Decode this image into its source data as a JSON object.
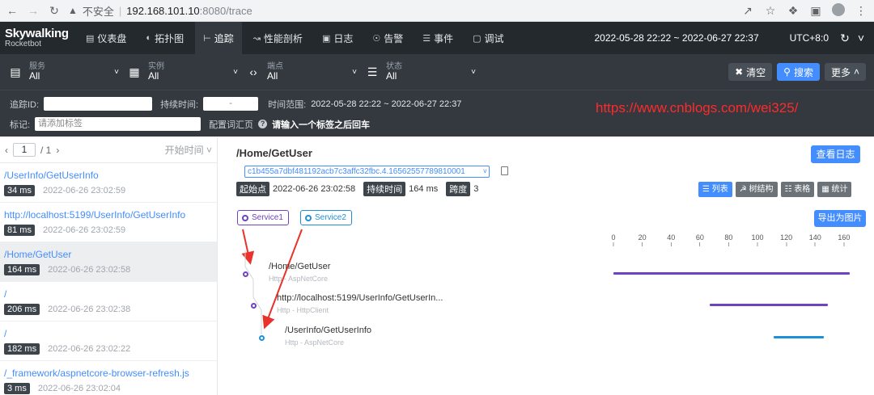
{
  "browser": {
    "insecure_label": "不安全",
    "host": "192.168.101.10",
    "path": ":8080/trace"
  },
  "brand": {
    "name": "Skywalking",
    "sub": "Rocketbot"
  },
  "menu": [
    {
      "label": "仪表盘",
      "icon": "dashboard-icon"
    },
    {
      "label": "拓扑图",
      "icon": "topology-icon"
    },
    {
      "label": "追踪",
      "icon": "trace-icon",
      "active": true
    },
    {
      "label": "性能剖析",
      "icon": "profile-icon"
    },
    {
      "label": "日志",
      "icon": "log-icon"
    },
    {
      "label": "告警",
      "icon": "alarm-icon"
    },
    {
      "label": "事件",
      "icon": "event-icon"
    },
    {
      "label": "调试",
      "icon": "debug-icon"
    }
  ],
  "header": {
    "daterange": "2022-05-28 22:22 ~ 2022-06-27 22:37",
    "timezone": "UTC+8:0"
  },
  "selectors": [
    {
      "label": "服务",
      "value": "All",
      "icon": "service-icon"
    },
    {
      "label": "实例",
      "value": "All",
      "icon": "instance-icon"
    },
    {
      "label": "端点",
      "value": "All",
      "icon": "endpoint-icon"
    },
    {
      "label": "状态",
      "value": "All",
      "icon": "status-icon"
    }
  ],
  "actions": {
    "clear": "清空",
    "search": "搜索",
    "more": "更多"
  },
  "filters": {
    "trace_id_label": "追踪ID:",
    "duration_label": "持续时间:",
    "duration_sep": "-",
    "time_range_label": "时间范围:",
    "time_range": "2022-05-28 22:22 ~ 2022-06-27 22:37",
    "tags_label": "标记:",
    "tags_placeholder": "请添加标签",
    "config_label": "配置词汇页",
    "tags_hint": "请输入一个标签之后回车"
  },
  "watermark": "https://www.cnblogs.com/wei325/",
  "pager": {
    "current": "1",
    "total": "/ 1",
    "sort": "开始时间"
  },
  "traces": [
    {
      "endpoint": "/UserInfo/GetUserInfo",
      "duration": "34 ms",
      "time": "2022-06-26 23:02:59"
    },
    {
      "endpoint": "http://localhost:5199/UserInfo/GetUserInfo",
      "duration": "81 ms",
      "time": "2022-06-26 23:02:59"
    },
    {
      "endpoint": "/Home/GetUser",
      "duration": "164 ms",
      "time": "2022-06-26 23:02:58",
      "selected": true
    },
    {
      "endpoint": "/",
      "duration": "206 ms",
      "time": "2022-06-26 23:02:38"
    },
    {
      "endpoint": "/",
      "duration": "182 ms",
      "time": "2022-06-26 23:02:22"
    },
    {
      "endpoint": "/_framework/aspnetcore-browser-refresh.js",
      "duration": "3 ms",
      "time": "2022-06-26 23:02:04"
    }
  ],
  "detail": {
    "title": "/Home/GetUser",
    "view_log": "查看日志",
    "trace_id": "c1b455a7dbf481192acb7c3affc32fbc.4.16562557789810001",
    "start_label": "起始点",
    "start": "2022-06-26 23:02:58",
    "duration_label": "持续时间",
    "duration": "164 ms",
    "span_label": "跨度",
    "span_count": "3",
    "views": [
      "列表",
      "树结构",
      "表格",
      "统计"
    ],
    "export": "导出为图片",
    "services": [
      {
        "name": "Service1",
        "color": "#6f42c1"
      },
      {
        "name": "Service2",
        "color": "#1e90d8"
      }
    ]
  },
  "timeline": {
    "ticks": [
      0,
      20,
      40,
      60,
      80,
      100,
      120,
      140,
      160
    ],
    "max": 164
  },
  "spans": [
    {
      "name": "/Home/GetUser",
      "sub": "Http - AspNetCore",
      "start": 0,
      "end": 164,
      "color": "#6f42c1",
      "depth": 0
    },
    {
      "name": "http://localhost:5199/UserInfo/GetUserIn...",
      "sub": "Http - HttpClient",
      "start": 67,
      "end": 149,
      "color": "#6f42c1",
      "depth": 1
    },
    {
      "name": "/UserInfo/GetUserInfo",
      "sub": "Http - AspNetCore",
      "start": 111,
      "end": 146,
      "color": "#1e90d8",
      "depth": 2
    }
  ]
}
